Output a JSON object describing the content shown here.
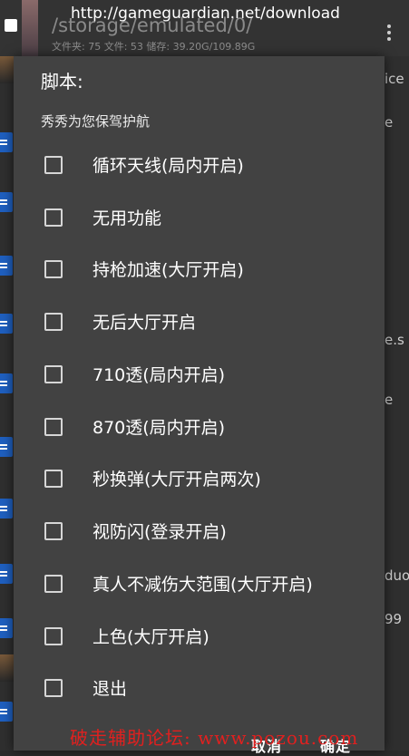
{
  "background": {
    "url": "http://gameguardian.net/download",
    "path": "/storage/emulated/0/",
    "stats": "文件夹: 75  文件: 53  储存: 39.20G/109.89G",
    "right_texts": [
      "ice",
      "e",
      "e.s",
      "e",
      "duo",
      "99"
    ]
  },
  "dialog": {
    "title": "脚本:",
    "subtitle": "秀秀为您保驾护航",
    "options": [
      {
        "label": "循环天线(局内开启)",
        "checked": false
      },
      {
        "label": "无用功能",
        "checked": false
      },
      {
        "label": "持枪加速(大厅开启)",
        "checked": false
      },
      {
        "label": "无后大厅开启",
        "checked": false
      },
      {
        "label": "710透(局内开启)",
        "checked": false
      },
      {
        "label": "870透(局内开启)",
        "checked": false
      },
      {
        "label": "秒换弹(大厅开启两次)",
        "checked": false
      },
      {
        "label": "视防闪(登录开启)",
        "checked": false
      },
      {
        "label": "真人不减伤大范围(大厅开启)",
        "checked": false
      },
      {
        "label": "上色(大厅开启)",
        "checked": false
      },
      {
        "label": "退出",
        "checked": false
      }
    ],
    "cancel_label": "取消",
    "ok_label": "确定"
  },
  "watermark": "破走辅助论坛: www.pozou.com"
}
